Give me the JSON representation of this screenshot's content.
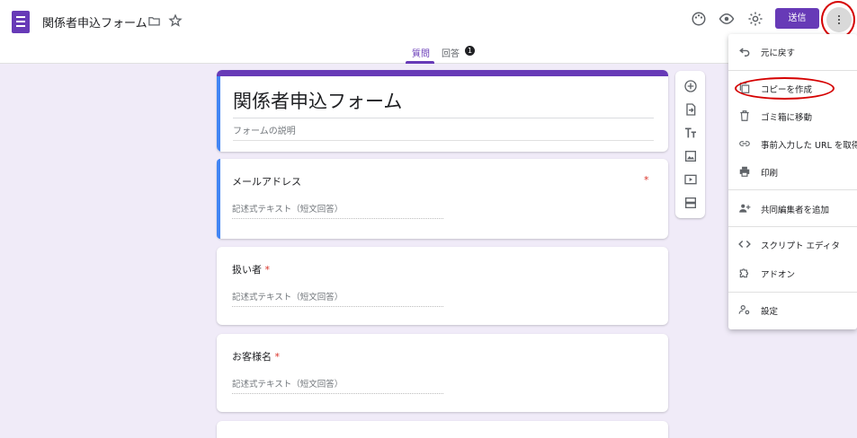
{
  "header": {
    "doc_title": "関係者申込フォーム",
    "send_label": "送信"
  },
  "tabs": {
    "questions": "質問",
    "responses": "回答",
    "responses_count": "1"
  },
  "form": {
    "title": "関係者申込フォーム",
    "description_placeholder": "フォームの説明"
  },
  "questions": [
    {
      "title": "メールアドレス",
      "required_mark": "*",
      "placeholder": "記述式テキスト（短文回答）"
    },
    {
      "title": "扱い者",
      "required_mark": "*",
      "placeholder": "記述式テキスト（短文回答）"
    },
    {
      "title": "お客様名",
      "required_mark": "*",
      "placeholder": "記述式テキスト（短文回答）"
    }
  ],
  "menu": {
    "items": [
      {
        "label": "元に戻す",
        "icon": "undo-icon"
      },
      {
        "label": "コピーを作成",
        "icon": "copy-icon"
      },
      {
        "label": "ゴミ箱に移動",
        "icon": "trash-icon"
      },
      {
        "label": "事前入力した URL を取得",
        "icon": "link-icon"
      },
      {
        "label": "印刷",
        "icon": "print-icon"
      },
      {
        "label": "共同編集者を追加",
        "icon": "add-people-icon"
      },
      {
        "label": "スクリプト エディタ",
        "icon": "code-icon"
      },
      {
        "label": "アドオン",
        "icon": "puzzle-icon"
      },
      {
        "label": "設定",
        "icon": "person-settings-icon"
      }
    ]
  },
  "colors": {
    "accent": "#673ab7",
    "background": "#f0ebf8",
    "selected_bar": "#4285f4",
    "annotation": "#d50000"
  }
}
